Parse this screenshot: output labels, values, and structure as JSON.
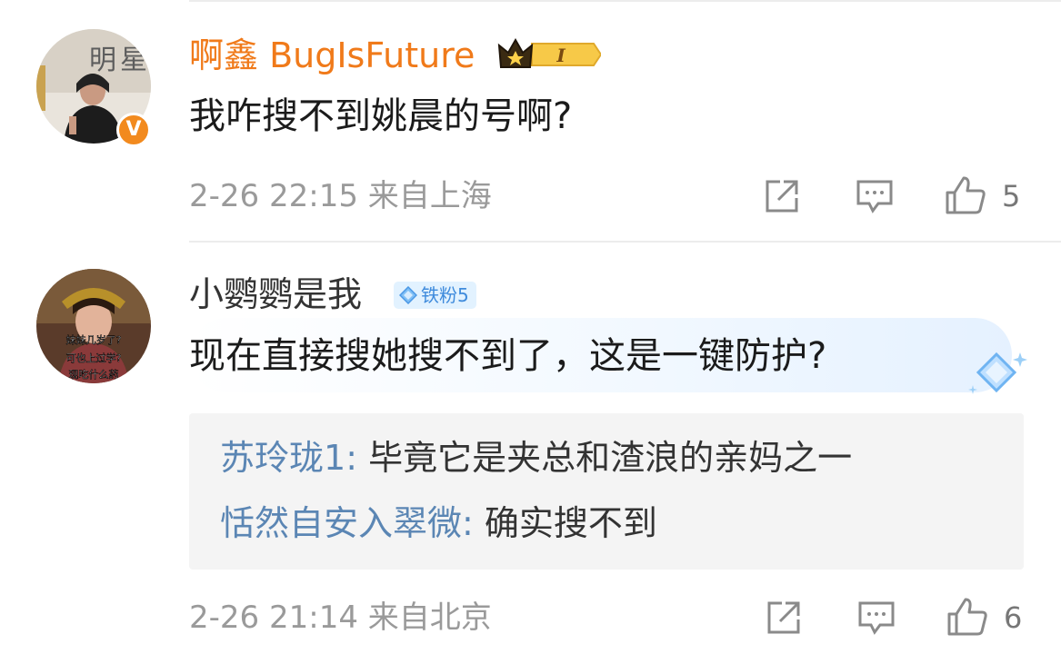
{
  "comments": [
    {
      "username": "啊鑫 BugIsFuture",
      "user_badge": "I",
      "user_badge_icon": "crown-icon",
      "verified_mark": "V",
      "text": "我咋搜不到姚晨的号啊?",
      "time": "2-26 22:15",
      "location": "来自上海",
      "likes": "5"
    },
    {
      "username": "小鹦鹦是我",
      "fan_badge": "铁粉5",
      "text": "现在直接搜她搜不到了，这是一键防护?",
      "avatar_caption": [
        "妹妹几岁了?",
        "可也上过学?",
        "现吃什么药"
      ],
      "replies": [
        {
          "user": "苏玲珑1",
          "text": "毕竟它是夹总和渣浪的亲妈之一"
        },
        {
          "user": "恬然自安入翠微",
          "text": "确实搜不到"
        }
      ],
      "time": "2-26 21:14",
      "location": "来自北京",
      "likes": "6"
    }
  ],
  "avatar1_art": [
    "明",
    "星"
  ],
  "colors": {
    "vip_name": "#f07a1a",
    "reply_user": "#5b86b4",
    "meta_text": "#9a9a9a",
    "fan_badge_bg": "#e2f2ff",
    "verified_bg": "#f28a1e"
  }
}
